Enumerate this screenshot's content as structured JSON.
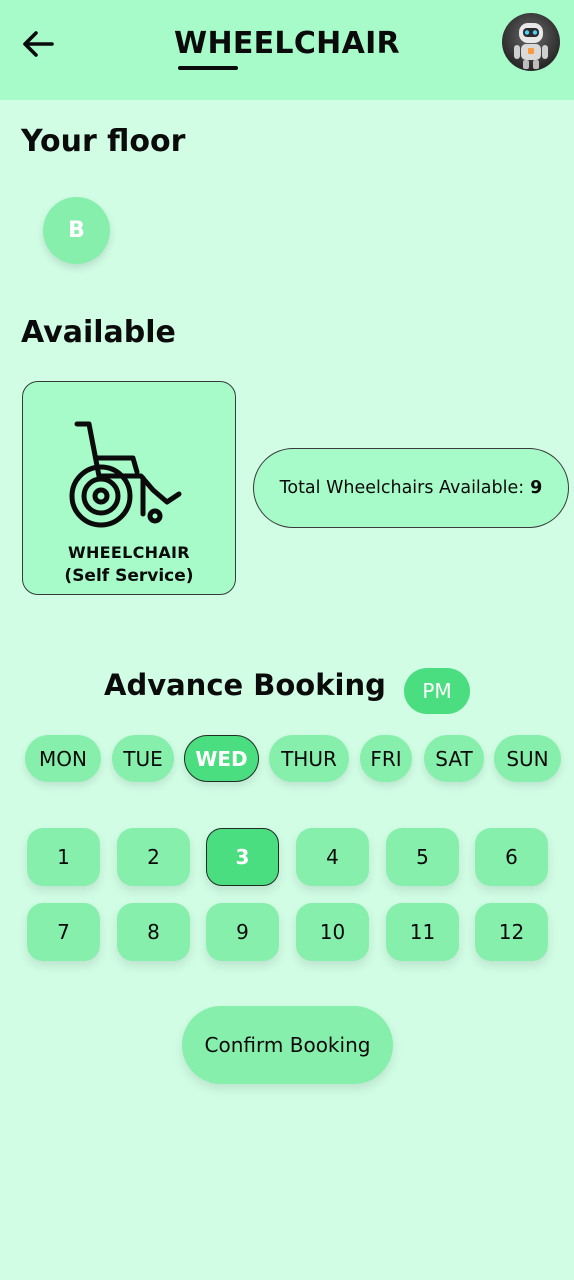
{
  "header": {
    "title": "WHEELCHAIR",
    "back_icon": "arrow-left-icon",
    "avatar_icon": "robot-avatar"
  },
  "floor": {
    "heading": "Your floor",
    "selected": "B"
  },
  "available": {
    "heading": "Available",
    "card_line1": "WHEELCHAIR",
    "card_line2": "(Self Service)",
    "card_icon": "wheelchair-icon",
    "total_label": "Total Wheelchairs Available:",
    "total_value": "9"
  },
  "booking": {
    "heading": "Advance Booking",
    "period": "PM",
    "days": [
      "MON",
      "TUE",
      "WED",
      "THUR",
      "FRI",
      "SAT",
      "SUN"
    ],
    "selected_day": "WED",
    "hours": [
      "1",
      "2",
      "3",
      "4",
      "5",
      "6",
      "7",
      "8",
      "9",
      "10",
      "11",
      "12"
    ],
    "selected_hour": "3",
    "confirm_label": "Confirm Booking"
  },
  "colors": {
    "header_bg": "#a6fbc8",
    "page_bg": "#d1fde5",
    "pill": "#86efac",
    "selected": "#4ade80"
  }
}
